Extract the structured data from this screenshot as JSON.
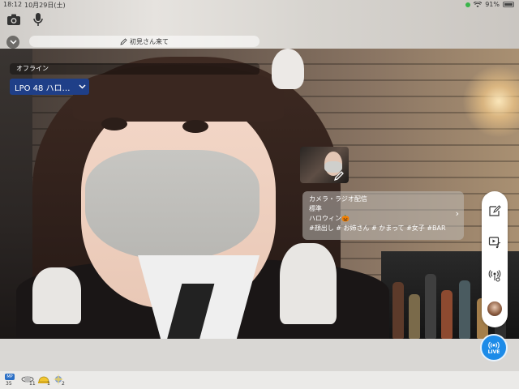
{
  "status_bar": {
    "time": "18:12",
    "date": "10月29日(土)",
    "battery": "91%"
  },
  "header": {
    "memo_text": "初見さん来て"
  },
  "broadcast": {
    "status": "オフライン",
    "selected_event": "LPO 48 ハロ…"
  },
  "info_card": {
    "type": "カメラ・ラジオ配信",
    "quality": "標準",
    "title": "ハロウィン🎃",
    "tags": "#顔出し # お姉さん # かまって #女子 #BAR"
  },
  "live_button": {
    "label": "LIVE"
  },
  "dock": {
    "item1_badge": "MP",
    "item1_count": "35",
    "item2_count": "11",
    "item3_count": "1",
    "item4_count": "2"
  },
  "colors": {
    "accent_blue": "#1d8be8",
    "event_select_bg": "#1f3f88",
    "status_green": "#3ab54a"
  }
}
